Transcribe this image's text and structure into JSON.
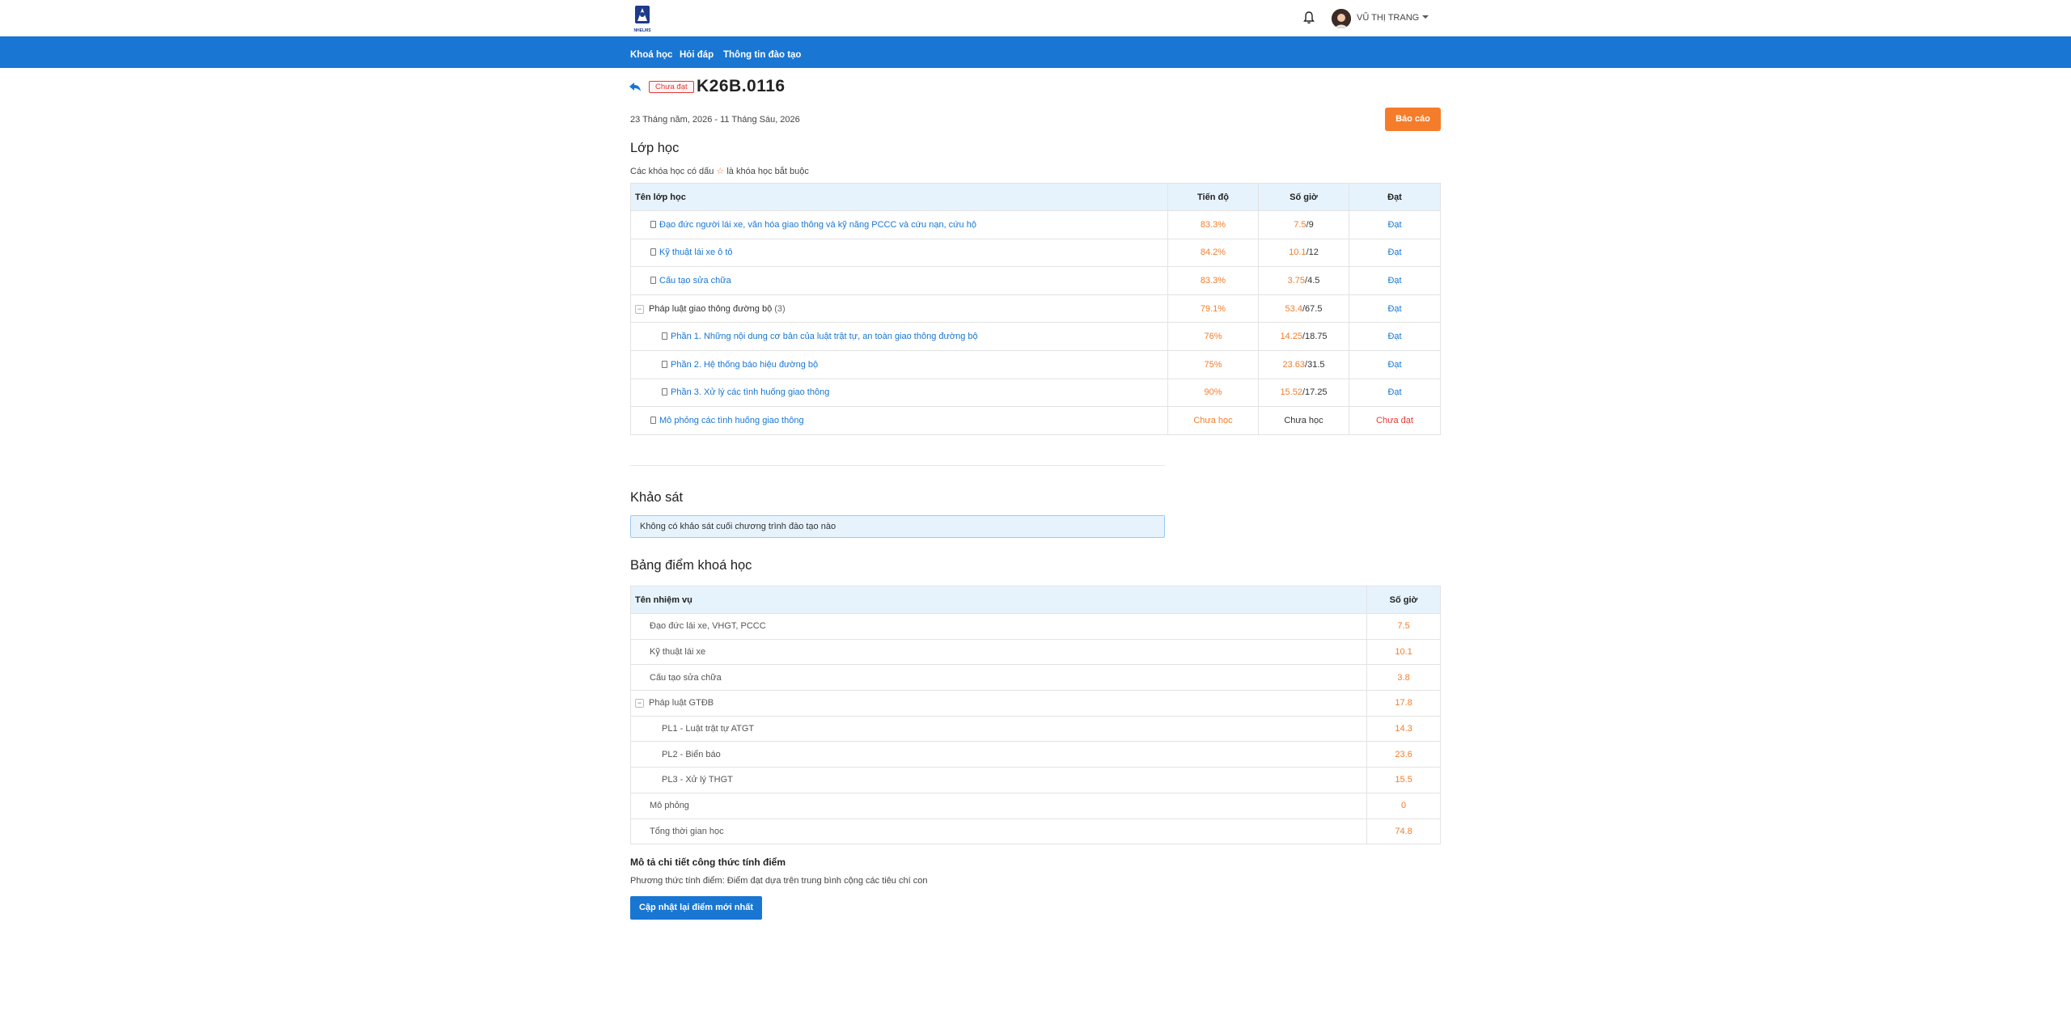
{
  "header": {
    "username": "VŨ THỊ TRANG",
    "logo_text": "NHELMS"
  },
  "nav": {
    "items": [
      "Khoá học",
      "Hỏi đáp",
      "Thông tin đào tạo"
    ]
  },
  "course": {
    "status": "Chưa đạt",
    "code": "K26B.0116",
    "date_range": "23 Tháng năm, 2026 - 11 Tháng Sáu, 2026",
    "report_label": "Báo cáo"
  },
  "classes": {
    "title": "Lớp học",
    "note_prefix": "Các khóa học có dấu",
    "note_star": "☆",
    "note_suffix": "là khóa học bắt buộc",
    "headers": [
      "Tên lớp học",
      "Tiến độ",
      "Số giờ",
      "Đạt"
    ],
    "rows": [
      {
        "name": "Đạo đức người lái xe, văn hóa giao thông và kỹ năng PCCC và cứu nạn, cứu hộ",
        "progress": "83.3%",
        "hours_done": "7.5",
        "hours_total": "/9",
        "result": "Đạt"
      },
      {
        "name": "Kỹ thuật lái xe ô tô",
        "progress": "84.2%",
        "hours_done": "10.1",
        "hours_total": "/12",
        "result": "Đạt"
      },
      {
        "name": "Cấu tạo sửa chữa",
        "progress": "83.3%",
        "hours_done": "3.75",
        "hours_total": "/4.5",
        "result": "Đạt"
      },
      {
        "name": "Pháp luật giao thông đường bộ",
        "count": "(3)",
        "progress": "79.1%",
        "hours_done": "53.4",
        "hours_total": "/67.5",
        "result": "Đạt"
      },
      {
        "name": "Phần 1. Những nội dung cơ bản của luật trật tự, an toàn giao thông đường bộ",
        "progress": "76%",
        "hours_done": "14.25",
        "hours_total": "/18.75",
        "result": "Đạt"
      },
      {
        "name": "Phần 2. Hệ thống báo hiệu đường bộ",
        "progress": "75%",
        "hours_done": "23.63",
        "hours_total": "/31.5",
        "result": "Đạt"
      },
      {
        "name": "Phần 3. Xử lý các tình huống giao thông",
        "progress": "90%",
        "hours_done": "15.52",
        "hours_total": "/17.25",
        "result": "Đạt"
      },
      {
        "name": "Mô phỏng các tình huống giao thông",
        "progress": "Chưa học",
        "hours_text": "Chưa học",
        "result": "Chưa đạt"
      }
    ]
  },
  "survey": {
    "title": "Khảo sát",
    "message": "Không có khảo sát cuối chương trình đào tạo nào"
  },
  "scores": {
    "title": "Bảng điểm khoá học",
    "headers": [
      "Tên nhiệm vụ",
      "Số giờ"
    ],
    "rows": [
      {
        "name": "Đạo đức lái xe, VHGT, PCCC",
        "value": "7.5"
      },
      {
        "name": "Kỹ thuật lái xe",
        "value": "10.1"
      },
      {
        "name": "Cấu tạo sửa chữa",
        "value": "3.8"
      },
      {
        "name": "Pháp luật GTĐB",
        "value": "17.8"
      },
      {
        "name": "PL1 - Luật trật tự ATGT",
        "value": "14.3"
      },
      {
        "name": "PL2 - Biển báo",
        "value": "23.6"
      },
      {
        "name": "PL3 - Xử lý THGT",
        "value": "15.5"
      },
      {
        "name": "Mô phỏng",
        "value": "0"
      },
      {
        "name": "Tổng thời gian học",
        "value": "74.8"
      }
    ]
  },
  "formula": {
    "title": "Mô tả chi tiết công thức tính điểm",
    "text": "Phương thức tính điểm: Điểm đạt dựa trên trung bình cộng các tiêu chí con",
    "update_label": "Cập nhật lại điểm mới nhất"
  },
  "colors": {
    "primary": "#1976d2",
    "accent": "#f57c2a",
    "danger": "#e53935",
    "header_bg": "#e6f3fd"
  }
}
